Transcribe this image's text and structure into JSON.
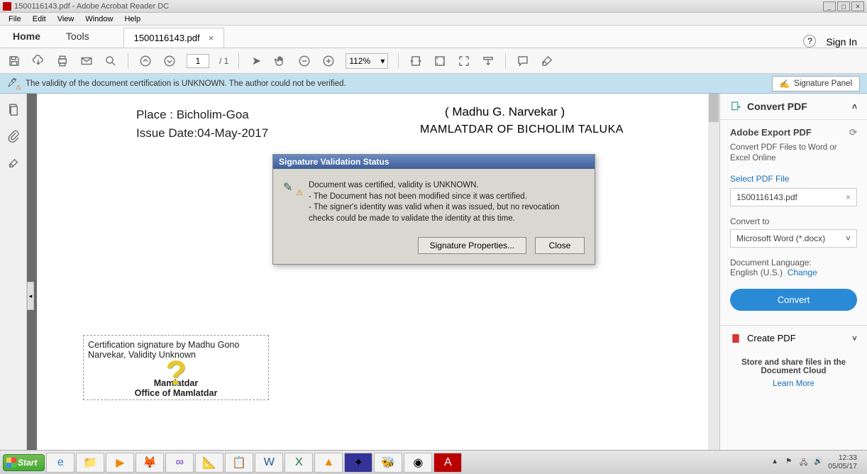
{
  "titlebar": {
    "text": "1500116143.pdf - Adobe Acrobat Reader DC"
  },
  "menubar": {
    "file": "File",
    "edit": "Edit",
    "view": "View",
    "window": "Window",
    "help": "Help"
  },
  "tabs": {
    "home": "Home",
    "tools": "Tools",
    "doc": "1500116143.pdf",
    "signin": "Sign In"
  },
  "toolbar": {
    "page_current": "1",
    "page_total": "/ 1",
    "zoom": "112%"
  },
  "certbar": {
    "msg": "The validity of the document certification is UNKNOWN. The author could not be verified.",
    "panel_btn": "Signature Panel"
  },
  "document": {
    "place_label": "Place : Bicholim-Goa",
    "issue_label": "Issue Date:04-May-2017",
    "signer_name": "( Madhu G. Narvekar )",
    "signer_title": "MAMLATDAR OF BICHOLIM TALUKA",
    "sigbox_line1": "Certification signature by Madhu Gono Narvekar, Validity Unknown",
    "sigbox_line2": "Mamlatdar",
    "sigbox_line3": "Office of Mamlatdar"
  },
  "dialog": {
    "title": "Signature Validation Status",
    "line1": "Document was certified, validity is UNKNOWN.",
    "line2": "- The Document has not been modified since it was certified.",
    "line3": "- The signer's identity was valid when it was issued, but no revocation checks could be made to validate the identity at this time.",
    "btn_props": "Signature Properties...",
    "btn_close": "Close"
  },
  "rightpanel": {
    "convert_head": "Convert PDF",
    "export_head": "Adobe Export PDF",
    "export_desc": "Convert PDF Files to Word or Excel Online",
    "select_label": "Select PDF File",
    "filename": "1500116143.pdf",
    "convert_to_label": "Convert to",
    "convert_to_value": "Microsoft Word (*.docx)",
    "lang_label": "Document Language:",
    "lang_value": "English (U.S.)",
    "change": "Change",
    "convert_btn": "Convert",
    "create_head": "Create PDF",
    "cloud_msg": "Store and share files in the Document Cloud",
    "learn": "Learn More"
  },
  "taskbar": {
    "start": "Start",
    "time": "12:33",
    "date": "05/05/17"
  }
}
